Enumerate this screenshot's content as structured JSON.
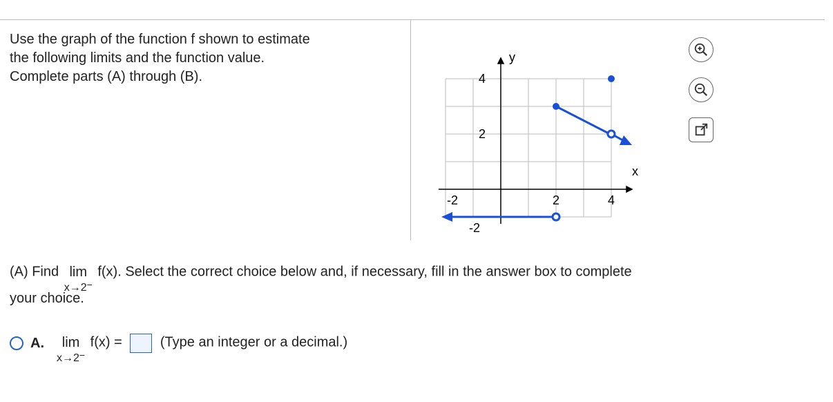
{
  "prompt": {
    "line1": "Use the graph of the function f shown to estimate",
    "line2": "the following limits and the function value.",
    "line3": "Complete parts (A) through (B)."
  },
  "graph": {
    "xlabel": "x",
    "ylabel": "y",
    "ticks": {
      "xneg2": "-2",
      "x2": "2",
      "x4": "4",
      "y2": "2",
      "y4": "4",
      "yneg2": "-2"
    }
  },
  "tools": {
    "zoom_in": "zoom-in",
    "zoom_out": "zoom-out",
    "popout": "popout"
  },
  "question": {
    "partA_lead": "(A) Find ",
    "lim_word": "lim",
    "lim_sub": "x→2",
    "fofx": "f(x).",
    "partA_tail": " Select the correct choice below and, if necessary, fill in the answer box to complete",
    "your_choice": "your choice."
  },
  "choice": {
    "label": "A.",
    "lim_word": "lim",
    "lim_sub": "x→2",
    "equals": " f(x) = ",
    "hint": "(Type an integer or a decimal.)"
  },
  "chart_data": {
    "type": "line",
    "title": "",
    "xlabel": "x",
    "ylabel": "y",
    "xlim": [
      -2,
      5
    ],
    "ylim": [
      -2,
      5
    ],
    "series": [
      {
        "name": "left-branch",
        "style": "solid-arrow-left-open-right",
        "points": [
          [
            -2,
            -1
          ],
          [
            2,
            -1
          ]
        ],
        "endpoints": {
          "right": "open"
        }
      },
      {
        "name": "right-branch",
        "style": "solid-closed-left-open-right-arrow",
        "points": [
          [
            2,
            3
          ],
          [
            4,
            2
          ]
        ],
        "endpoints": {
          "left": "closed",
          "right": "open-arrow"
        }
      }
    ],
    "isolated_points": [
      {
        "x": 4,
        "y": 4,
        "style": "closed"
      }
    ]
  }
}
